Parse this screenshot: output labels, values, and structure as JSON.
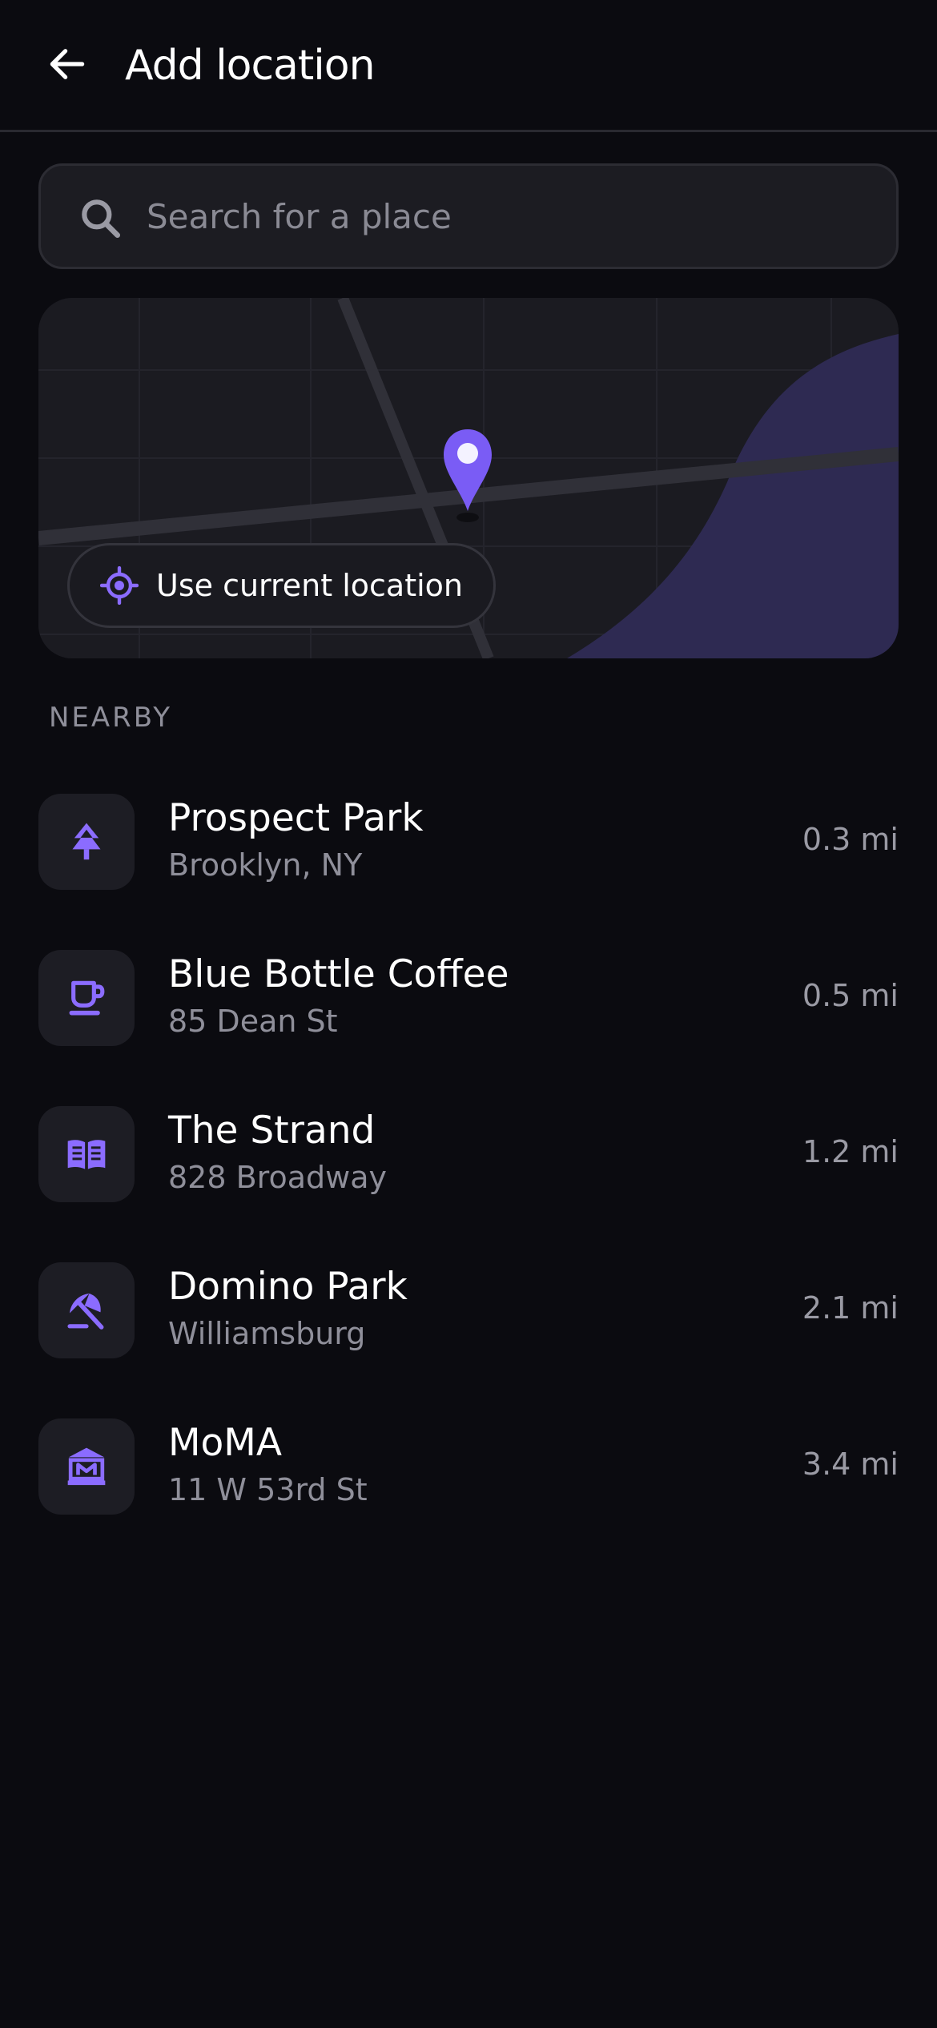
{
  "header": {
    "title": "Add location",
    "back_icon": "arrow-left-icon"
  },
  "search": {
    "placeholder": "Search for a place",
    "value": "",
    "icon": "search-icon"
  },
  "map": {
    "use_current_label": "Use current location",
    "accent": "#7a5cf5",
    "pin_icon": "map-pin-icon",
    "crosshair_icon": "crosshair-icon"
  },
  "nearby": {
    "label": "NEARBY",
    "places": [
      {
        "name": "Prospect Park",
        "subtitle": "Brooklyn, NY",
        "distance": "0.3 mi",
        "icon": "tree-icon"
      },
      {
        "name": "Blue Bottle Coffee",
        "subtitle": "85 Dean St",
        "distance": "0.5 mi",
        "icon": "coffee-cup-icon"
      },
      {
        "name": "The Strand",
        "subtitle": "828 Broadway",
        "distance": "1.2 mi",
        "icon": "book-icon"
      },
      {
        "name": "Domino Park",
        "subtitle": "Williamsburg",
        "distance": "2.1 mi",
        "icon": "beach-umbrella-icon"
      },
      {
        "name": "MoMA",
        "subtitle": "11 W 53rd St",
        "distance": "3.4 mi",
        "icon": "museum-icon"
      }
    ]
  },
  "colors": {
    "background": "#0b0b10",
    "surface": "#1c1c22",
    "accent": "#7a5cf5",
    "text_primary": "#ffffff",
    "text_secondary": "#8f8f9a"
  }
}
